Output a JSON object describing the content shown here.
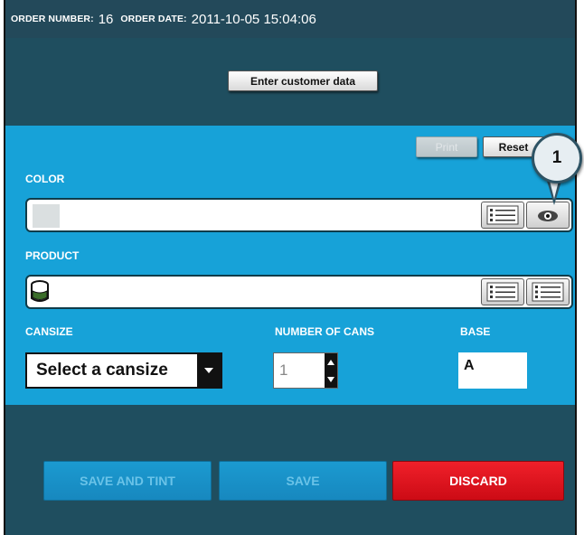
{
  "header": {
    "order_number_label": "ORDER NUMBER:",
    "order_number": "16",
    "order_date_label": "ORDER DATE:",
    "order_date": "2011-10-05 15:04:06"
  },
  "customer": {
    "button_label": "Enter customer data"
  },
  "panel": {
    "print_label": "Print",
    "reset_label": "Reset",
    "color_label": "COLOR",
    "product_label": "PRODUCT",
    "cansize_label": "CANSIZE",
    "number_of_cans_label": "NUMBER OF CANS",
    "base_label": "BASE",
    "cansize_selected": "Select a cansize",
    "number_of_cans_value": "1",
    "base_value": "A",
    "callout_number": "1"
  },
  "footer": {
    "save_and_tint_label": "SAVE AND TINT",
    "save_label": "SAVE",
    "discard_label": "DISCARD"
  },
  "icons": {
    "color_list": "list-icon",
    "color_view": "eye-icon",
    "product_icon": "paint-can-icon",
    "product_list_1": "list-icon",
    "product_list_2": "list-icon",
    "dropdown": "chevron-down-icon"
  },
  "colors": {
    "background": "#1f4e5f",
    "panel": "#17a2d8",
    "discard": "#e51922"
  }
}
